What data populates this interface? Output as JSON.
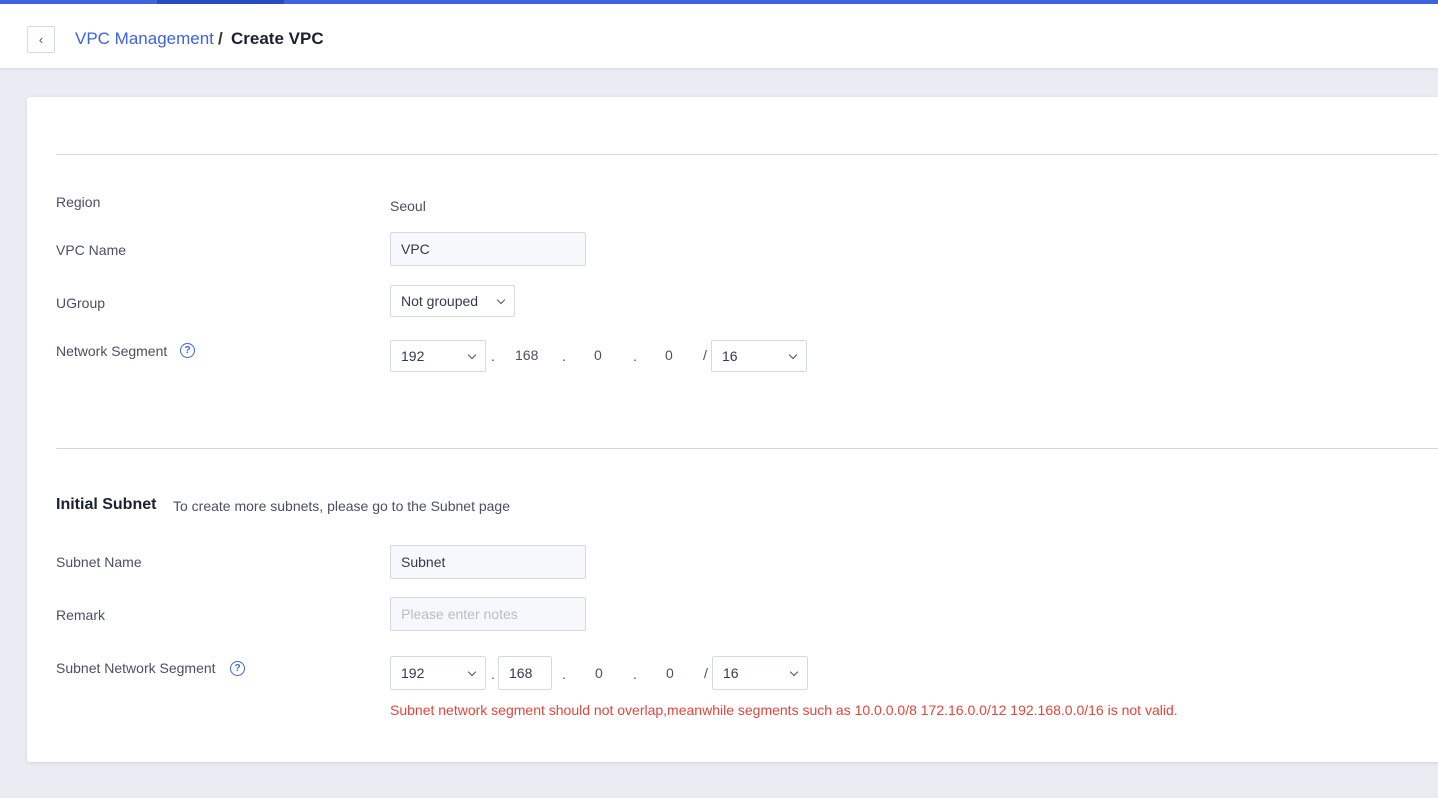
{
  "header": {
    "back_icon": "chevron-left-icon",
    "breadcrumb_link": "VPC Management",
    "breadcrumb_separator": "/",
    "breadcrumb_current": "Create VPC"
  },
  "vpc": {
    "region_label": "Region",
    "region_value": "Seoul",
    "name_label": "VPC Name",
    "name_value": "VPC",
    "ugroup_label": "UGroup",
    "ugroup_value": "Not grouped",
    "segment_label": "Network Segment",
    "segment": {
      "o1": "192",
      "o2": "168",
      "o3": "0",
      "o4": "0",
      "mask": "16"
    }
  },
  "subnet": {
    "title": "Initial Subnet",
    "hint": "To create more subnets, please go to the Subnet page",
    "name_label": "Subnet Name",
    "name_value": "Subnet",
    "remark_label": "Remark",
    "remark_placeholder": "Please enter notes",
    "segment_label": "Subnet Network Segment",
    "segment": {
      "o1": "192",
      "o2": "168",
      "o3": "0",
      "o4": "0",
      "mask": "16"
    },
    "error": "Subnet network segment should not overlap,meanwhile segments such as 10.0.0.0/8 172.16.0.0/12 192.168.0.0/16 is not valid."
  },
  "colors": {
    "accent": "#3e63dd",
    "error": "#e0463b"
  }
}
